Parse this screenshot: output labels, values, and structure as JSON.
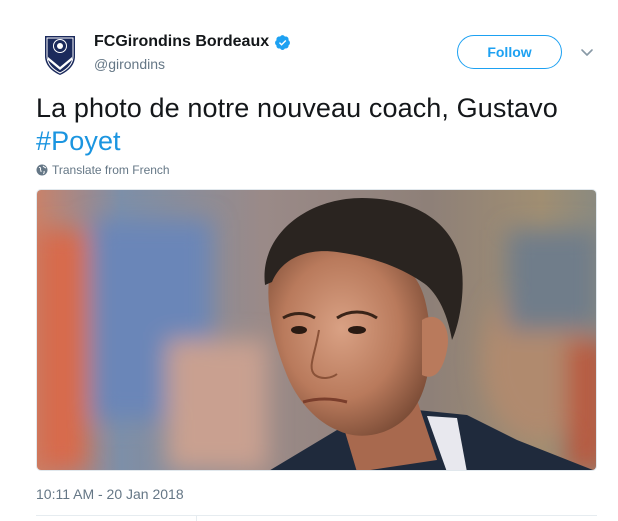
{
  "tweet": {
    "author": {
      "display_name": "FCGirondins Bordeaux",
      "handle": "@girondins",
      "verified": true,
      "avatar_icon": "fc-girondins-crest-icon"
    },
    "follow_label": "Follow",
    "text_prefix": "La photo de notre nouveau coach, Gustavo ",
    "hashtag": "#Poyet",
    "translate_label": "Translate from French",
    "timestamp": "10:11 AM - 20 Jan 2018",
    "media": {
      "type": "photo",
      "description_icon": "coach-portrait-photo"
    }
  },
  "colors": {
    "accent": "#1da1f2",
    "hashtag": "#1b95e0",
    "secondary_text": "#657786",
    "primary_text": "#14171a",
    "crest_navy": "#1b2a5c"
  }
}
